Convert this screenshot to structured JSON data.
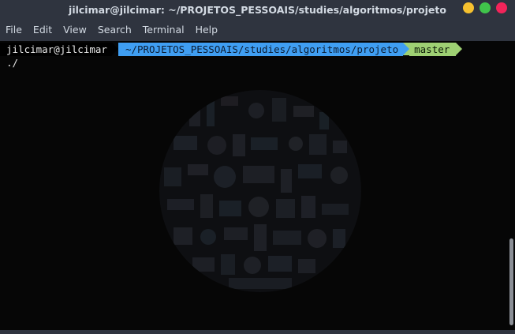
{
  "window": {
    "title": "jilcimar@jilcimar: ~/PROJETOS_PESSOAIS/studies/algoritmos/projeto"
  },
  "colors": {
    "titlebar_bg": "#2f343f",
    "title_text": "#d3dae3",
    "minimize": "#f6c12f",
    "maximize": "#40c44b",
    "close": "#f2245a",
    "terminal_bg": "#060606",
    "prompt_path_bg": "#3f9ef2",
    "prompt_git_bg": "#9ed073"
  },
  "menu": {
    "items": [
      "File",
      "Edit",
      "View",
      "Search",
      "Terminal",
      "Help"
    ]
  },
  "terminal": {
    "prompt": {
      "user_host": "jilcimar@jilcimar",
      "path": "~/PROJETOS_PESSOAIS/studies/algoritmos/projeto",
      "git_icon": "branch-icon",
      "git_symbol": "",
      "branch": "master"
    },
    "output": [
      "./"
    ]
  }
}
